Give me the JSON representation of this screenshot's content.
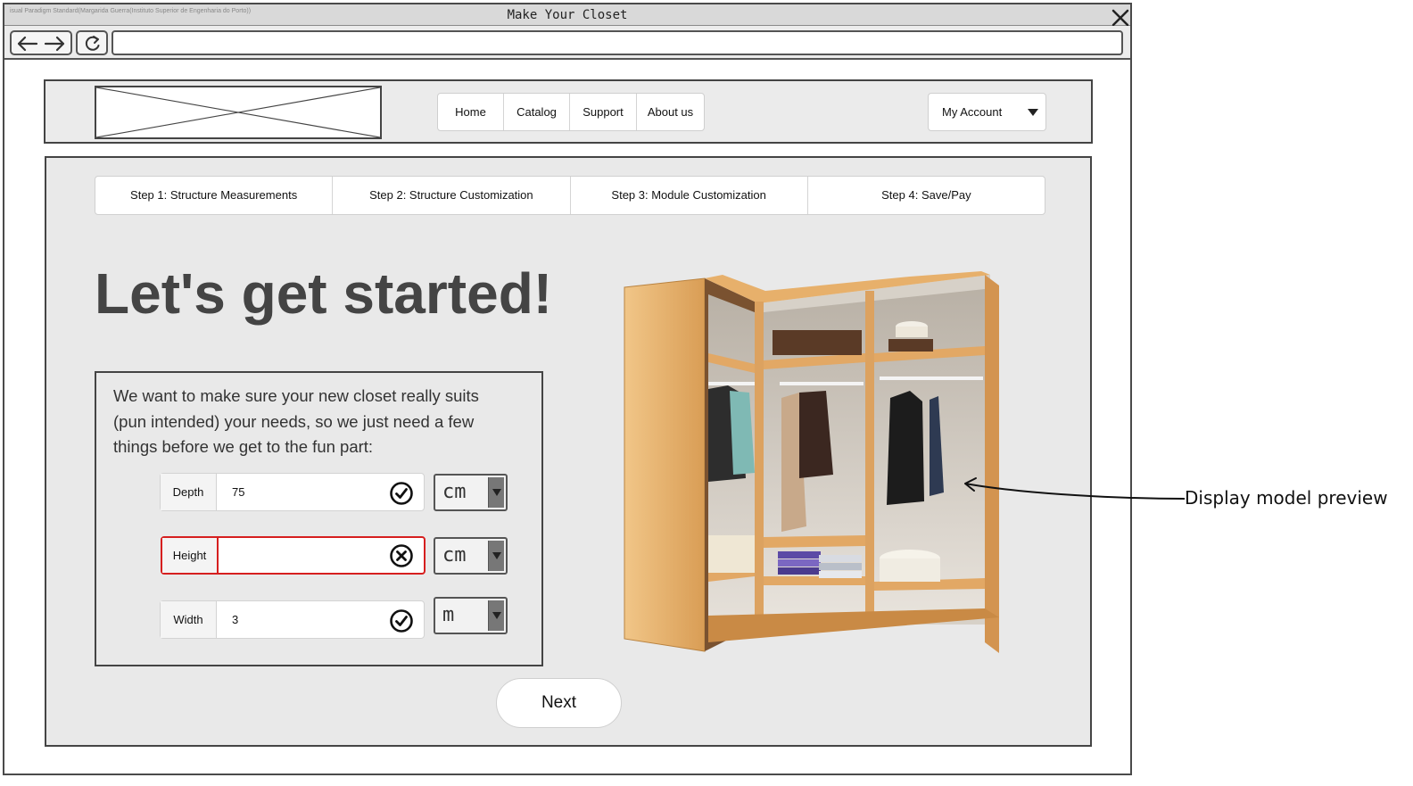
{
  "window": {
    "title": "Make Your Closet",
    "watermark": "isual Paradigm Standard(Margarida Guerra(Instituto Superior de Engenharia do Porto))"
  },
  "header": {
    "menu": [
      "Home",
      "Catalog",
      "Support",
      "About us"
    ],
    "account_label": "My Account"
  },
  "steps": [
    "Step 1: Structure Measurements",
    "Step 2: Structure Customization",
    "Step 3: Module Customization",
    "Step 4: Save/Pay"
  ],
  "main": {
    "headline": "Let's get started!",
    "intro": "We want to make sure your new closet really suits (pun intended) your needs, so we just need a few things before we get to the fun part:",
    "next_label": "Next"
  },
  "fields": {
    "depth": {
      "label": "Depth",
      "value": "75",
      "unit": "cm",
      "status": "valid"
    },
    "height": {
      "label": "Height",
      "value": "",
      "unit": "cm",
      "status": "error"
    },
    "width": {
      "label": "Width",
      "value": "3",
      "unit": "m",
      "status": "valid"
    }
  },
  "annotation": {
    "text": "Display model preview"
  },
  "colors": {
    "error": "#d61f1f",
    "panel_bg": "#e9e9e9",
    "wood": "#e2a865"
  },
  "icons": {
    "close": "close-icon",
    "back": "arrow-left-icon",
    "forward": "arrow-right-icon",
    "refresh": "refresh-icon",
    "dropdown": "caret-down-icon",
    "valid": "check-circle-icon",
    "invalid": "x-circle-icon"
  }
}
